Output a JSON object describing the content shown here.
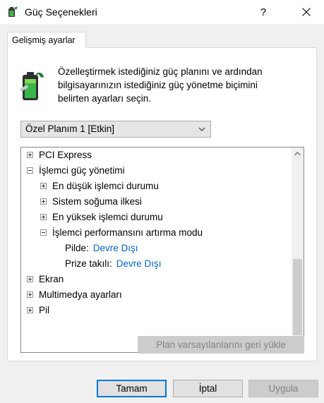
{
  "window": {
    "title": "Güç Seçenekleri",
    "help_label": "?"
  },
  "tab": {
    "label": "Gelişmiş ayarlar"
  },
  "description": {
    "line1": "Özelleştirmek istediğiniz güç planını ve ardından",
    "line2": "bilgisayarınızın istediğiniz güç yönetme biçimini",
    "line3": "belirten ayarları seçin."
  },
  "plan_select": {
    "value": "Özel Planım 1 [Etkin]"
  },
  "tree": {
    "items": [
      {
        "label": "PCI Express",
        "state": "collapsed"
      },
      {
        "label": "İşlemci güç yönetimi",
        "state": "expanded"
      },
      {
        "label": "En düşük işlemci durumu",
        "state": "collapsed"
      },
      {
        "label": "Sistem soğuma ilkesi",
        "state": "collapsed"
      },
      {
        "label": "En yüksek işlemci durumu",
        "state": "collapsed"
      },
      {
        "label": "İşlemci performansını artırma modu",
        "state": "expanded"
      },
      {
        "label": "Pilde:",
        "value": "Devre Dışı"
      },
      {
        "label": "Prize takılı:",
        "value": "Devre Dışı"
      },
      {
        "label": "Ekran",
        "state": "collapsed"
      },
      {
        "label": "Multimedya ayarları",
        "state": "collapsed"
      },
      {
        "label": "Pil",
        "state": "collapsed"
      }
    ]
  },
  "buttons": {
    "restore": "Plan varsayılanlarını geri yükle",
    "ok": "Tamam",
    "cancel": "İptal",
    "apply": "Uygula"
  },
  "colors": {
    "accent": "#0078d7",
    "link": "#0066cc",
    "disabled_text": "#838383"
  }
}
